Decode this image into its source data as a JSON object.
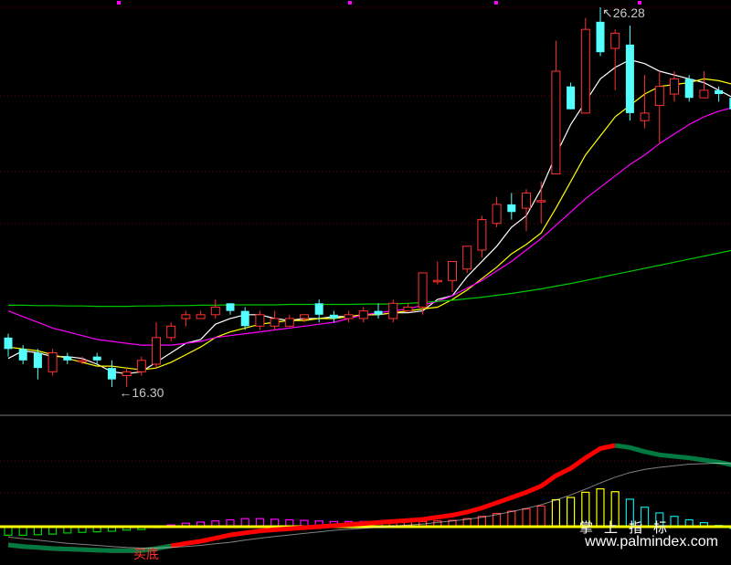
{
  "chart_data": {
    "type": "candlestick",
    "high_label": "26.28",
    "low_label": "16.30",
    "signal_text": "买底",
    "colors": {
      "up": "#ff3232",
      "down": "#54ffff",
      "ma5": "#ffffff",
      "ma10": "#ffff00",
      "ma20": "#ff00ff",
      "ma60": "#00c800",
      "dif": "#ff0000",
      "dea": "#007a40",
      "zero": "#ffff00"
    },
    "candles": [
      [
        17.6,
        17.7,
        17.1,
        17.3
      ],
      [
        17.3,
        17.4,
        16.9,
        17.0
      ],
      [
        17.2,
        17.3,
        16.5,
        16.8
      ],
      [
        16.7,
        17.3,
        16.6,
        17.2
      ],
      [
        17.1,
        17.2,
        16.9,
        17.0
      ],
      [
        17.0,
        17.1,
        16.9,
        17.0
      ],
      [
        17.1,
        17.2,
        16.9,
        17.0
      ],
      [
        16.8,
        17.0,
        16.3,
        16.5
      ],
      [
        16.6,
        16.8,
        16.3,
        16.7
      ],
      [
        16.7,
        17.1,
        16.6,
        17.0
      ],
      [
        16.9,
        18.0,
        16.8,
        17.6
      ],
      [
        17.6,
        18.0,
        17.5,
        17.9
      ],
      [
        18.1,
        18.3,
        17.9,
        18.2
      ],
      [
        18.1,
        18.3,
        18.1,
        18.2
      ],
      [
        18.2,
        18.6,
        18.1,
        18.4
      ],
      [
        18.5,
        18.5,
        18.2,
        18.3
      ],
      [
        18.3,
        18.4,
        17.8,
        17.9
      ],
      [
        17.9,
        18.3,
        17.8,
        18.2
      ],
      [
        17.9,
        18.3,
        17.8,
        18.1
      ],
      [
        17.9,
        18.2,
        17.9,
        18.1
      ],
      [
        18.1,
        18.2,
        18.0,
        18.2
      ],
      [
        18.5,
        18.6,
        18.0,
        18.2
      ],
      [
        18.2,
        18.3,
        18.0,
        18.1
      ],
      [
        18.1,
        18.3,
        18.0,
        18.2
      ],
      [
        18.1,
        18.4,
        18.0,
        18.3
      ],
      [
        18.3,
        18.5,
        18.1,
        18.2
      ],
      [
        18.1,
        18.6,
        18.0,
        18.5
      ],
      [
        18.3,
        18.5,
        18.3,
        18.4
      ],
      [
        18.4,
        19.0,
        18.2,
        19.3
      ],
      [
        19.1,
        19.6,
        19.0,
        19.1
      ],
      [
        19.1,
        19.6,
        18.8,
        19.6
      ],
      [
        19.4,
        20.0,
        19.3,
        20.0
      ],
      [
        19.9,
        20.8,
        19.7,
        20.7
      ],
      [
        20.6,
        21.3,
        20.5,
        21.1
      ],
      [
        21.1,
        21.4,
        20.7,
        20.9
      ],
      [
        21.0,
        21.5,
        20.4,
        21.4
      ],
      [
        21.2,
        21.7,
        20.6,
        21.2
      ],
      [
        21.9,
        25.4,
        21.9,
        24.6
      ],
      [
        24.2,
        24.3,
        23.6,
        23.6
      ],
      [
        23.5,
        26.0,
        23.6,
        25.7
      ],
      [
        25.9,
        26.28,
        25.0,
        25.1
      ],
      [
        25.2,
        25.7,
        24.1,
        25.6
      ],
      [
        25.3,
        25.8,
        23.3,
        23.5
      ],
      [
        23.3,
        24.5,
        23.1,
        23.5
      ],
      [
        23.7,
        24.6,
        22.7,
        24.2
      ],
      [
        24.0,
        24.6,
        23.8,
        24.4
      ],
      [
        24.4,
        24.5,
        23.8,
        23.9
      ],
      [
        23.9,
        24.6,
        23.9,
        24.1
      ],
      [
        24.1,
        24.2,
        23.8,
        24.0
      ],
      [
        23.9,
        24.1,
        23.6,
        23.6
      ],
      [
        23.7,
        23.9,
        23.4,
        23.4
      ],
      [
        23.4,
        23.8,
        23.6,
        23.8
      ],
      [
        23.9,
        24.1,
        23.9,
        24.1
      ],
      [
        24.1,
        24.4,
        23.8,
        23.8
      ],
      [
        23.6,
        24.6,
        23.3,
        23.6
      ],
      [
        23.8,
        23.9,
        23.4,
        23.6
      ],
      [
        23.6,
        23.6,
        23.4,
        23.5
      ],
      [
        23.6,
        23.9,
        22.9,
        23.0
      ],
      [
        22.9,
        22.9,
        22.6,
        22.6
      ],
      [
        22.4,
        23.5,
        22.2,
        22.5
      ]
    ],
    "ma_series": [
      {
        "id": "ma5",
        "values": [
          17.05,
          17.25,
          17.2,
          17.1,
          17.1,
          17.05,
          16.9,
          16.7,
          16.65,
          16.7,
          16.95,
          17.2,
          17.45,
          17.55,
          17.95,
          18.1,
          18.2,
          18.2,
          18.1,
          18.05,
          18.1,
          18.1,
          18.15,
          18.15,
          18.2,
          18.2,
          18.25,
          18.25,
          18.3,
          18.6,
          18.7,
          19.2,
          19.6,
          20.0,
          20.5,
          20.8,
          21.5,
          22.4,
          23.2,
          23.8,
          24.4,
          24.7,
          24.9,
          24.8,
          24.6,
          24.5,
          24.4,
          24.3,
          24.1,
          23.9,
          23.85,
          23.8,
          23.95,
          23.95,
          23.9,
          23.85,
          23.8,
          23.9,
          23.7,
          23.3
        ]
      },
      {
        "id": "ma10",
        "values": [
          17.35,
          17.3,
          17.25,
          17.15,
          17.05,
          16.95,
          16.85,
          16.85,
          16.8,
          16.75,
          16.8,
          16.95,
          17.15,
          17.35,
          17.6,
          17.75,
          17.85,
          17.95,
          18.0,
          18.05,
          18.05,
          18.1,
          18.1,
          18.15,
          18.2,
          18.2,
          18.25,
          18.3,
          18.35,
          18.4,
          18.6,
          18.85,
          19.15,
          19.45,
          19.8,
          20.05,
          20.35,
          21.0,
          21.7,
          22.4,
          22.9,
          23.4,
          23.7,
          24.0,
          24.2,
          24.25,
          24.3,
          24.4,
          24.35,
          24.25,
          24.15,
          24.1,
          24.0,
          23.95,
          23.9,
          23.85,
          23.85,
          23.8,
          23.6,
          23.4
        ]
      },
      {
        "id": "ma20",
        "values": [
          18.3,
          18.15,
          18.0,
          17.85,
          17.75,
          17.65,
          17.55,
          17.5,
          17.45,
          17.4,
          17.4,
          17.4,
          17.45,
          17.5,
          17.6,
          17.65,
          17.7,
          17.75,
          17.8,
          17.85,
          17.9,
          17.95,
          18.0,
          18.1,
          18.2,
          18.25,
          18.3,
          18.35,
          18.45,
          18.55,
          18.7,
          18.9,
          19.1,
          19.35,
          19.6,
          19.9,
          20.2,
          20.55,
          20.9,
          21.25,
          21.55,
          21.85,
          22.15,
          22.4,
          22.7,
          22.95,
          23.2,
          23.4,
          23.55,
          23.65,
          23.75,
          23.8,
          23.85,
          23.9,
          23.95,
          24.0,
          24.0,
          24.05,
          24.05,
          24.05
        ]
      },
      {
        "id": "ma60",
        "values": [
          18.45,
          18.45,
          18.44,
          18.44,
          18.43,
          18.43,
          18.42,
          18.42,
          18.42,
          18.43,
          18.43,
          18.44,
          18.44,
          18.45,
          18.45,
          18.46,
          18.46,
          18.46,
          18.46,
          18.47,
          18.47,
          18.47,
          18.47,
          18.47,
          18.48,
          18.48,
          18.48,
          18.5,
          18.52,
          18.55,
          18.58,
          18.62,
          18.66,
          18.71,
          18.76,
          18.82,
          18.88,
          18.95,
          19.02,
          19.1,
          19.18,
          19.26,
          19.34,
          19.42,
          19.5,
          19.58,
          19.66,
          19.74,
          19.82,
          19.9,
          19.98,
          20.05,
          20.12,
          20.2,
          20.28,
          20.36,
          20.44,
          20.52,
          20.6,
          20.7
        ]
      }
    ],
    "macd": {
      "dif": [
        -0.35,
        -0.38,
        -0.4,
        -0.42,
        -0.43,
        -0.44,
        -0.45,
        -0.46,
        -0.46,
        -0.46,
        -0.42,
        -0.37,
        -0.32,
        -0.28,
        -0.22,
        -0.16,
        -0.12,
        -0.08,
        -0.06,
        -0.04,
        -0.02,
        0.0,
        0.02,
        0.04,
        0.06,
        0.08,
        0.1,
        0.12,
        0.14,
        0.18,
        0.22,
        0.28,
        0.36,
        0.46,
        0.56,
        0.66,
        0.78,
        0.98,
        1.12,
        1.32,
        1.5,
        1.56,
        1.52,
        1.44,
        1.38,
        1.35,
        1.32,
        1.28,
        1.24,
        1.18,
        1.1,
        1.04,
        1.0,
        0.96,
        0.92,
        0.88,
        0.84,
        0.78,
        0.7,
        0.62
      ],
      "dea": [
        -0.2,
        -0.23,
        -0.26,
        -0.29,
        -0.32,
        -0.34,
        -0.36,
        -0.38,
        -0.4,
        -0.41,
        -0.41,
        -0.4,
        -0.38,
        -0.36,
        -0.33,
        -0.3,
        -0.26,
        -0.22,
        -0.19,
        -0.16,
        -0.13,
        -0.1,
        -0.07,
        -0.05,
        -0.03,
        -0.01,
        0.01,
        0.03,
        0.05,
        0.08,
        0.11,
        0.14,
        0.18,
        0.23,
        0.29,
        0.35,
        0.42,
        0.51,
        0.61,
        0.72,
        0.84,
        0.95,
        1.04,
        1.1,
        1.14,
        1.17,
        1.2,
        1.21,
        1.22,
        1.21,
        1.19,
        1.16,
        1.13,
        1.1,
        1.06,
        1.02,
        0.98,
        0.93,
        0.88,
        0.82
      ],
      "hist": [
        -0.3,
        -0.3,
        -0.28,
        -0.26,
        -0.22,
        -0.2,
        -0.18,
        -0.16,
        -0.12,
        -0.1,
        -0.02,
        0.06,
        0.12,
        0.16,
        0.2,
        0.24,
        0.28,
        0.28,
        0.26,
        0.24,
        0.22,
        0.2,
        0.18,
        0.18,
        0.18,
        0.18,
        0.18,
        0.18,
        0.18,
        0.2,
        0.22,
        0.28,
        0.36,
        0.46,
        0.54,
        0.62,
        0.72,
        0.94,
        1.02,
        1.2,
        1.32,
        1.22,
        0.96,
        0.68,
        0.48,
        0.36,
        0.24,
        0.14,
        0.04,
        -0.06,
        -0.18,
        -0.24,
        -0.26,
        -0.28,
        -0.28,
        -0.28,
        -0.28,
        -0.3,
        -0.36,
        -0.4
      ]
    }
  },
  "watermark": {
    "cn": "掌上指标",
    "url": "www.palmindex.com"
  }
}
